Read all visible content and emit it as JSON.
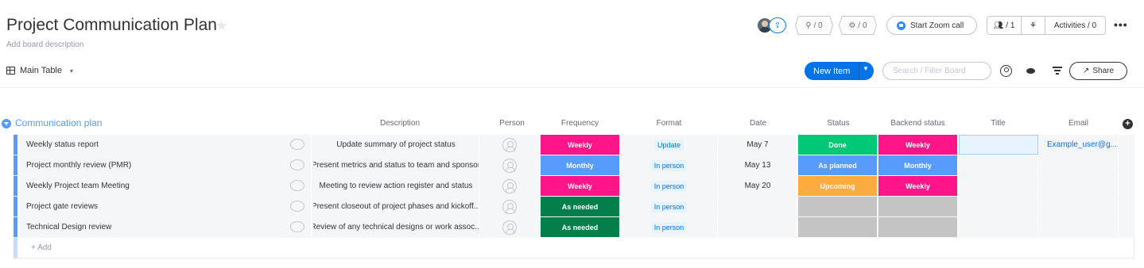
{
  "board": {
    "title": "Project Communication Plan",
    "description_placeholder": "Add board description"
  },
  "header": {
    "integrations_count": "/ 0",
    "automations_count": "/ 0",
    "zoom_label": "Start Zoom call",
    "members_count": "/ 1",
    "activities_label": "Activities / 0",
    "more": "•••"
  },
  "toolbar": {
    "view_label": "Main Table",
    "new_item_label": "New Item",
    "search_placeholder": "Search / Filter Board",
    "share_label": "Share"
  },
  "colors": {
    "accent": "#0073ea",
    "group": "#579bfc",
    "weekly": "#ff158a",
    "monthly": "#579bfc",
    "as_needed": "#037f4c",
    "done": "#00c875",
    "upcoming": "#fdab3d",
    "empty_status": "#c4c4c4"
  },
  "group": {
    "title": "Communication plan",
    "columns": [
      "Description",
      "Person",
      "Frequency",
      "Format",
      "Date",
      "Status",
      "Backend status",
      "Title",
      "Email"
    ],
    "rows": [
      {
        "name": "Weekly status report",
        "description": "Update summary of project status",
        "frequency": "Weekly",
        "frequency_color": "#ff158a",
        "format": "Update",
        "date": "May 7",
        "status": "Done",
        "status_color": "#00c875",
        "backend_status": "Weekly",
        "backend_color": "#ff158a",
        "title": "",
        "email": "Example_user@g..."
      },
      {
        "name": "Project monthly review (PMR)",
        "description": "Present metrics and status to team and sponsor",
        "frequency": "Monthly",
        "frequency_color": "#579bfc",
        "format": "In person",
        "date": "May 13",
        "status": "As planned",
        "status_color": "#579bfc",
        "backend_status": "Monthly",
        "backend_color": "#579bfc",
        "title": "",
        "email": ""
      },
      {
        "name": "Weekly Project team Meeting",
        "description": "Meeting to review action register and status",
        "frequency": "Weekly",
        "frequency_color": "#ff158a",
        "format": "In person",
        "date": "May 20",
        "status": "Upcoming",
        "status_color": "#fdab3d",
        "backend_status": "Weekly",
        "backend_color": "#ff158a",
        "title": "",
        "email": ""
      },
      {
        "name": "Project gate reviews",
        "description": "Present closeout of project phases and kickoff...",
        "frequency": "As needed",
        "frequency_color": "#037f4c",
        "format": "In person",
        "date": "",
        "status": "",
        "status_color": "#c4c4c4",
        "backend_status": "",
        "backend_color": "#c4c4c4",
        "title": "",
        "email": ""
      },
      {
        "name": "Technical Design review",
        "description": "Review of any technical designs or work assoc...",
        "frequency": "As needed",
        "frequency_color": "#037f4c",
        "format": "In person",
        "date": "",
        "status": "",
        "status_color": "#c4c4c4",
        "backend_status": "",
        "backend_color": "#c4c4c4",
        "title": "",
        "email": ""
      }
    ],
    "add_label": "+ Add"
  }
}
